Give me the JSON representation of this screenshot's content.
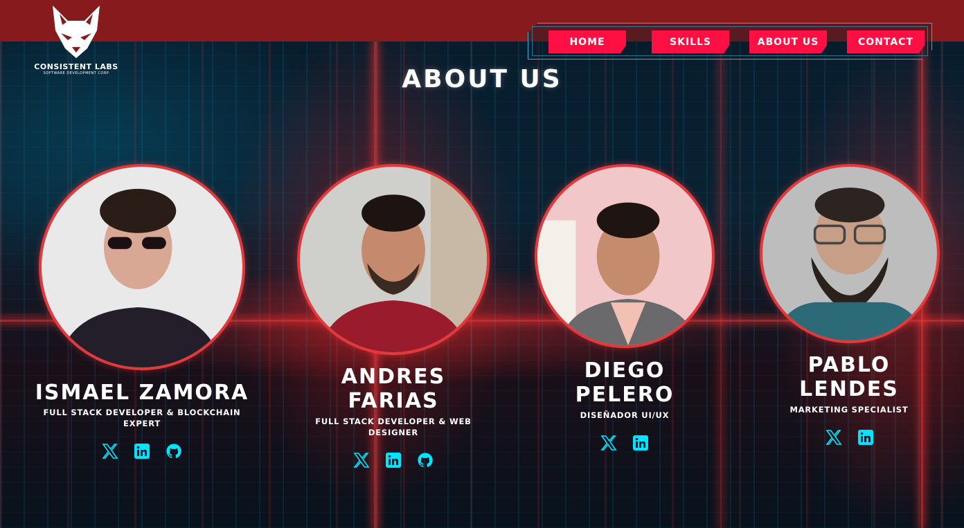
{
  "header": {
    "logo_name": "CONSISTENT LABS",
    "logo_sub": "SOFTWARE DEVELOPMENT CORP",
    "nav": [
      "HOME",
      "SKILLS",
      "ABOUT US",
      "CONTACT"
    ]
  },
  "page_title": "ABOUT US",
  "members": [
    {
      "name_line1": "ISMAEL ZAMORA",
      "name_line2": "",
      "role": "FULL STACK DEVELOPER & BLOCKCHAIN EXPERT",
      "social": [
        "x-icon",
        "linkedin-icon",
        "github-icon"
      ]
    },
    {
      "name_line1": "ANDRES",
      "name_line2": "FARIAS",
      "role": "FULL STACK DEVELOPER & WEB DESIGNER",
      "social": [
        "x-icon",
        "linkedin-icon",
        "github-icon"
      ]
    },
    {
      "name_line1": "DIEGO",
      "name_line2": "PELERO",
      "role": "DISEñADOR UI/UX",
      "social": [
        "x-icon",
        "linkedin-icon"
      ]
    },
    {
      "name_line1": "PABLO",
      "name_line2": "LENDES",
      "role": "MARKETING SPECIALIST",
      "social": [
        "x-icon",
        "linkedin-icon"
      ]
    }
  ],
  "colors": {
    "header": "#861a1c",
    "nav_button": "#ff1044",
    "accent_cyan": "#00e5ff",
    "photo_border": "#e5383b"
  }
}
